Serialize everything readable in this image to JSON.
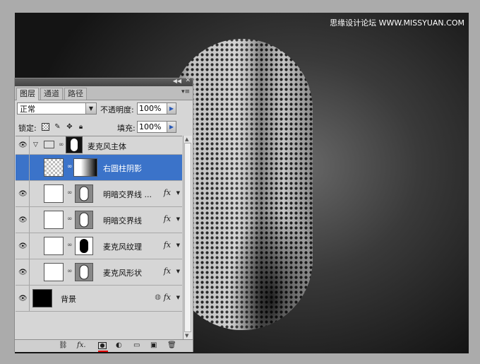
{
  "watermark": "思缘设计论坛 WWW.MISSYUAN.COM",
  "panel": {
    "tabs": [
      {
        "label": "图层",
        "active": true
      },
      {
        "label": "通道",
        "active": false
      },
      {
        "label": "路径",
        "active": false
      }
    ],
    "blend_mode": "正常",
    "opacity_label": "不透明度:",
    "opacity_value": "100%",
    "lock_label": "锁定:",
    "fill_label": "填充:",
    "fill_value": "100%"
  },
  "layers": [
    {
      "name": "麦克风主体",
      "type": "group",
      "visible": true,
      "selected": false
    },
    {
      "name": "右圆柱阴影",
      "type": "layer",
      "visible": false,
      "selected": true
    },
    {
      "name": "明暗交界线 ...",
      "type": "layer",
      "visible": true,
      "selected": false,
      "fx": "fx"
    },
    {
      "name": "明暗交界线",
      "type": "layer",
      "visible": true,
      "selected": false,
      "fx": "fx"
    },
    {
      "name": "麦克风纹理",
      "type": "layer",
      "visible": true,
      "selected": false,
      "fx": "fx"
    },
    {
      "name": "麦克风形状",
      "type": "layer",
      "visible": true,
      "selected": false,
      "fx": "fx"
    },
    {
      "name": "背景",
      "type": "background",
      "visible": true,
      "selected": false,
      "fx": "fx"
    }
  ],
  "bottom_bar": {
    "fx_label": "fx."
  },
  "colors": {
    "selection": "#3b73c9",
    "active_indicator": "#e00000"
  }
}
